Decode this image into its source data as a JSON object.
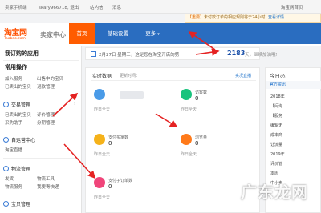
{
  "topbar": {
    "items": [
      "卖家手机端",
      "skary966718, 退出",
      "站内信",
      "消息"
    ],
    "right": "淘宝网首页"
  },
  "notice": {
    "tag": "【重要】",
    "text": "未付款订单的相应规则将于24小时!",
    "link": "查看详情"
  },
  "brand": {
    "logo_cn": "淘宝网",
    "logo_en": "Taobao.com",
    "title": "卖家中心"
  },
  "nav": {
    "items": [
      "首页",
      "基础设置",
      "更多"
    ],
    "active_index": 0,
    "active_color": "#ff5c00",
    "bar_color": "#2a6dc0"
  },
  "sidebar": {
    "my_apps": "我订购的应用",
    "common_ops": "常用操作",
    "ops": [
      {
        "left": "加入服务",
        "right": "出售中的宝贝"
      },
      {
        "left": "已卖出的宝贝",
        "right": "退款管理"
      }
    ],
    "groups": [
      {
        "label": "交易管理",
        "links": [
          [
            "已卖出的宝贝",
            "评价管理"
          ],
          [
            "采购助手",
            "分期管理"
          ]
        ]
      },
      {
        "label": "自运营中心",
        "links": [
          [
            "淘宝直播",
            ""
          ]
        ]
      },
      {
        "label": "物流管理",
        "links": [
          [
            "发货",
            "物流工具"
          ],
          [
            "物流服务",
            "我要寄快递"
          ]
        ]
      },
      {
        "label": "宝贝管理",
        "links": []
      }
    ]
  },
  "date_bar": {
    "date": "2月27日",
    "weekday": "星期三",
    "greeting": "这是您在淘宝开店的第",
    "days": "2183",
    "tail": "天，继续加油哦!"
  },
  "realtime": {
    "title": "实时数据",
    "dropdown": "更新时间：",
    "link": "实况直播",
    "metrics": [
      {
        "label": "",
        "value": "",
        "prev": "昨日全天",
        "icon": "cloud-icon",
        "color": "#4a9be8"
      },
      {
        "label": "访客数",
        "value": "0",
        "prev": "昨日全天",
        "icon": "person-icon",
        "color": "#19c37d"
      },
      {
        "label": "支付买家数",
        "value": "0",
        "prev": "昨日全天",
        "icon": "buyers-icon",
        "color": "#f5b21a"
      },
      {
        "label": "浏览量",
        "value": "0",
        "prev": "昨日全天",
        "icon": "eye-icon",
        "color": "#ff7a1a"
      },
      {
        "label": "支付子订单数",
        "value": "0",
        "prev": "昨日全天",
        "icon": "order-icon",
        "color": "#f0457a"
      }
    ]
  },
  "right_panel": {
    "title": "今日必",
    "tab": "官方资讯",
    "items": [
      "2018年",
      "【问询",
      "【服务",
      "编辑无",
      "成本商",
      "让流量",
      "2019年",
      "评价管",
      "本周",
      "中小卖"
    ]
  },
  "watermark": "广东龙网"
}
